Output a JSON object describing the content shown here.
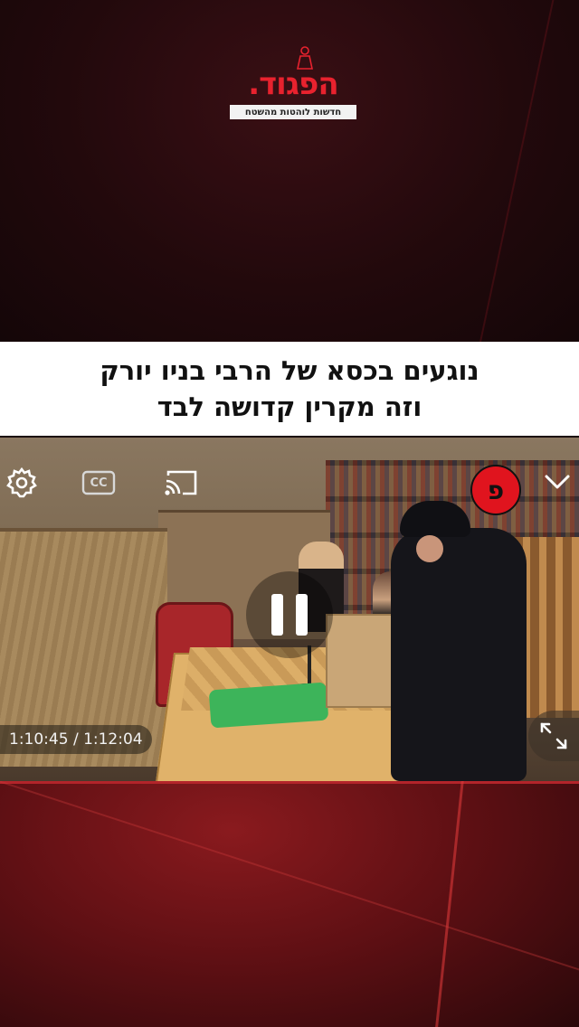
{
  "logo": {
    "name": "הפגוד.",
    "tagline": "חדשות לוהטות מהשטח"
  },
  "headline": {
    "line1": "נוגעים בכסא של הרבי בניו יורק",
    "line2": "וזה מקרין קדושה לבד"
  },
  "player": {
    "cc_label": "CC",
    "badge_label": "פ",
    "current_time": "1:10:45",
    "duration": "1:12:04",
    "time_display": "1:10:45 / 1:12:04",
    "state": "playing",
    "icons": {
      "settings": "gear-icon",
      "captions": "cc-icon",
      "cast": "cast-icon",
      "collapse": "chevron-down-icon",
      "pause": "pause-icon",
      "fullscreen": "fullscreen-icon"
    }
  },
  "colors": {
    "brand_red": "#e8222e",
    "headline_bg": "#ffffff",
    "headline_text": "#111111",
    "background_dark": "#1a0b0d",
    "background_red": "#8a1a1e"
  }
}
